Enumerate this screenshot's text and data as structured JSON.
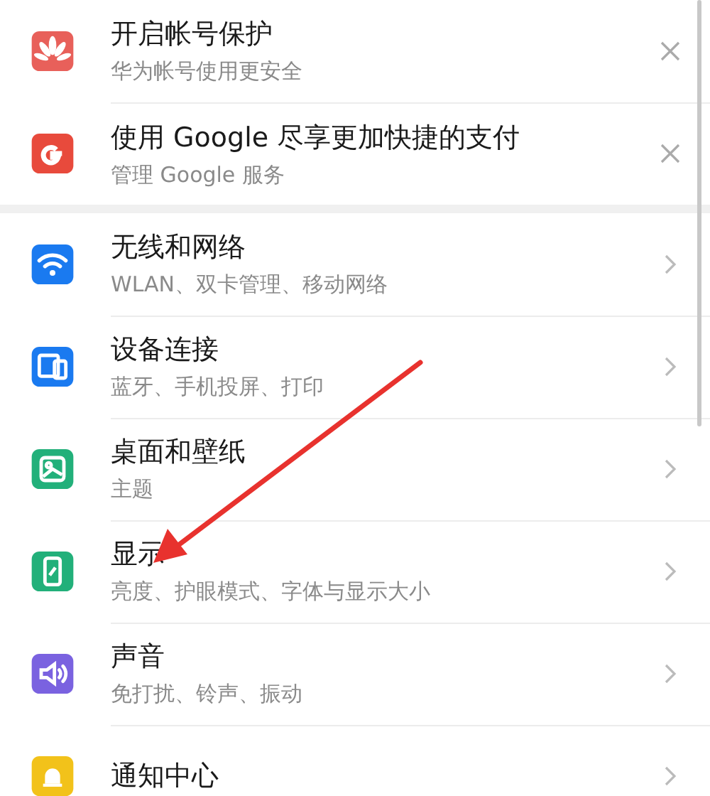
{
  "suggestions": [
    {
      "kind": "dismissable",
      "color": "#e8605a",
      "title": "开启帐号保护",
      "subtitle": "华为帐号使用更安全"
    },
    {
      "kind": "dismissable",
      "color": "#e84a3c",
      "title": "使用 Google 尽享更加快捷的支付",
      "subtitle": "管理 Google 服务"
    }
  ],
  "settings": [
    {
      "kind": "link",
      "color": "#1a7af0",
      "title": "无线和网络",
      "subtitle": "WLAN、双卡管理、移动网络"
    },
    {
      "kind": "link",
      "color": "#1a7af0",
      "title": "设备连接",
      "subtitle": "蓝牙、手机投屏、打印"
    },
    {
      "kind": "link",
      "color": "#22b07a",
      "title": "桌面和壁纸",
      "subtitle": "主题"
    },
    {
      "kind": "link",
      "color": "#22b07a",
      "title": "显示",
      "subtitle": "亮度、护眼模式、字体与显示大小"
    },
    {
      "kind": "link",
      "color": "#7a62e0",
      "title": "声音",
      "subtitle": "免打扰、铃声、振动"
    },
    {
      "kind": "link",
      "color": "#f2c21a",
      "title": "通知中心"
    }
  ]
}
